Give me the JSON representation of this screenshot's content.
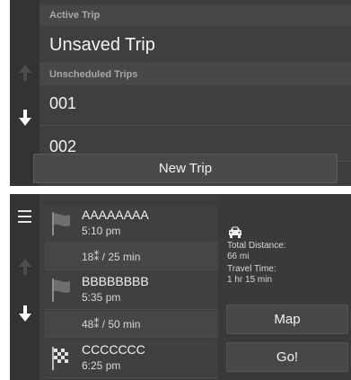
{
  "screen1": {
    "section_active": "Active Trip",
    "active_trip": "Unsaved Trip",
    "section_unscheduled": "Unscheduled Trips",
    "trips": [
      "001",
      "002"
    ],
    "new_trip_label": "New Trip"
  },
  "screen2": {
    "waypoints": [
      {
        "name": "AAAAAAAA",
        "time": "5:10 pm",
        "icon": "flag-icon"
      },
      {
        "name": "BBBBBBBB",
        "time": "5:35 pm",
        "icon": "flag-icon"
      },
      {
        "name": "CCCCCCC",
        "time": "6:25 pm",
        "icon": "checkered-flag-icon"
      }
    ],
    "legs": [
      "18⁑ / 25 min",
      "48⁑ / 50 min"
    ],
    "info": {
      "car_icon": "car-icon",
      "total_distance_label": "Total Distance:",
      "total_distance_value": "66 mi",
      "travel_time_label": "Travel Time:",
      "travel_time_value": "1 hr 15 min"
    },
    "map_label": "Map",
    "go_label": "Go!"
  },
  "colors": {
    "background": "#3d3d3d",
    "header": "#474747",
    "text": "#f2f2f2"
  }
}
